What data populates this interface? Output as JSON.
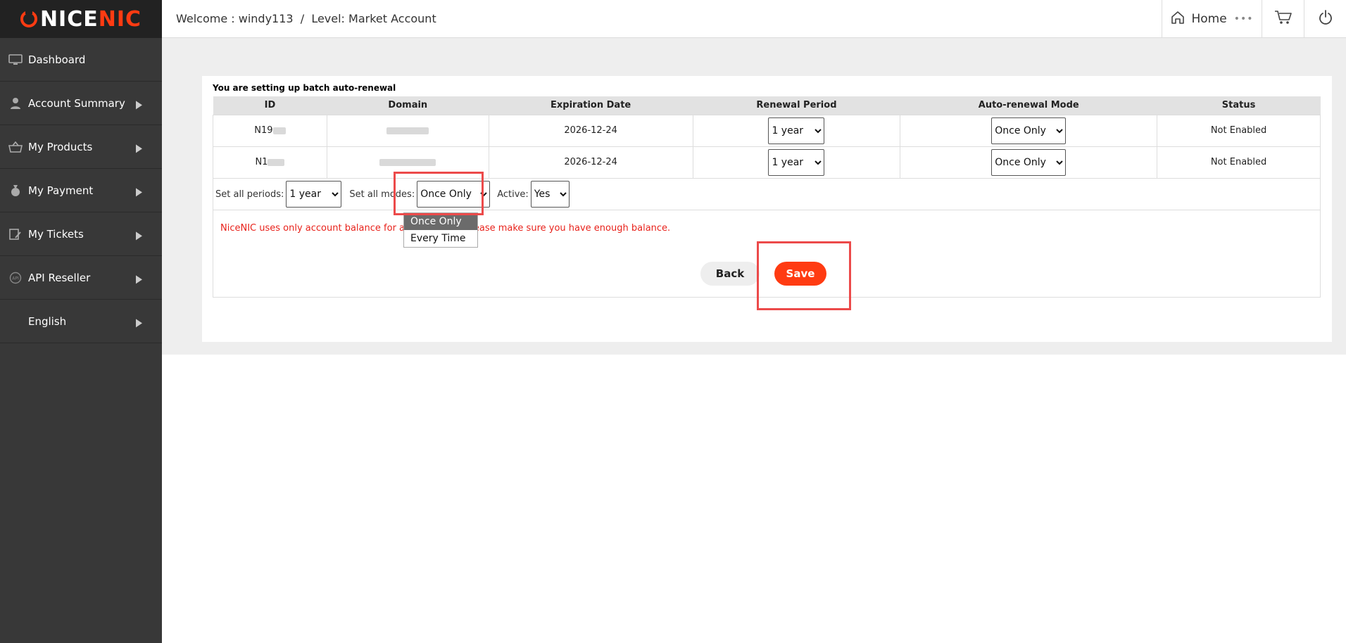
{
  "brand": {
    "logo_white": "NICE",
    "logo_red": "NIC"
  },
  "sidebar": {
    "items": [
      {
        "label": "Dashboard",
        "icon": "monitor-icon",
        "has_arrow": false
      },
      {
        "label": "Account Summary",
        "icon": "user-icon",
        "has_arrow": true
      },
      {
        "label": "My Products",
        "icon": "basket-icon",
        "has_arrow": true
      },
      {
        "label": "My Payment",
        "icon": "money-bag-icon",
        "has_arrow": true
      },
      {
        "label": "My Tickets",
        "icon": "ticket-icon",
        "has_arrow": true
      },
      {
        "label": "API Reseller",
        "icon": "api-icon",
        "has_arrow": true
      },
      {
        "label": "English",
        "icon": "",
        "has_arrow": true
      }
    ]
  },
  "header": {
    "welcome": "Welcome : windy113  /  Level: Market Account",
    "home_label": "Home",
    "more_label": "•••"
  },
  "page": {
    "title": "You are setting up batch auto-renewal",
    "columns": [
      "ID",
      "Domain",
      "Expiration Date",
      "Renewal Period",
      "Auto-renewal Mode",
      "Status"
    ],
    "rows": [
      {
        "id": "N19",
        "expiration": "2026-12-24",
        "period": "1 year",
        "mode": "Once Only",
        "status": "Not Enabled"
      },
      {
        "id": "N1",
        "expiration": "2026-12-24",
        "period": "1 year",
        "mode": "Once Only",
        "status": "Not Enabled"
      }
    ],
    "batch": {
      "periods_label": "Set all periods:",
      "periods_value": "1 year",
      "modes_label": "Set all modes:",
      "modes_value": "Once Only",
      "active_label": "Active:",
      "active_value": "Yes"
    },
    "dropdown_options": [
      "Once Only",
      "Every Time"
    ],
    "notice": "NiceNIC uses only account balance for auto-renewal, please make sure you have enough balance.",
    "back_label": "Back",
    "save_label": "Save"
  },
  "colors": {
    "brand": "#ff3b12",
    "sidebar": "#383838",
    "highlight": "#ec4a4a",
    "status": "#e8221b"
  }
}
